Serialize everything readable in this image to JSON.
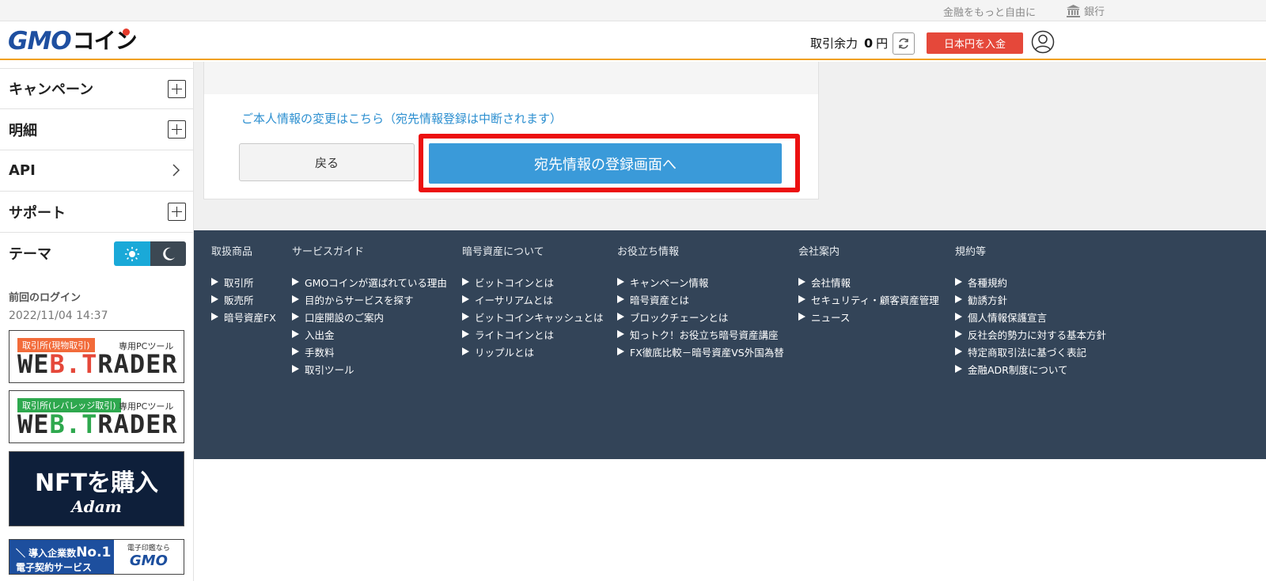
{
  "topbar": {
    "tagline": "金融をもっと自由に",
    "bank_label": "銀行"
  },
  "header": {
    "logo_gmo": "GMO",
    "logo_coin": "コイン",
    "balance_label": "取引余力",
    "balance_value": "0",
    "balance_unit": "円",
    "deposit_label": "日本円を入金"
  },
  "sidebar": {
    "items": [
      {
        "label": "キャンペーン",
        "control": "plus"
      },
      {
        "label": "明細",
        "control": "plus"
      },
      {
        "label": "API",
        "control": "chevron"
      },
      {
        "label": "サポート",
        "control": "plus"
      }
    ],
    "theme_label": "テーマ",
    "last_login_label": "前回のログイン",
    "last_login_value": "2022/11/04 14:37",
    "banners": {
      "webtrader_spot": {
        "tag": "取引所(現物取引)",
        "sub": "専用PCツール",
        "logo": "WEB.TRADER",
        "tag_color": "#f26b3a"
      },
      "webtrader_leverage": {
        "tag": "取引所(レバレッジ取引)",
        "sub": "専用PCツール",
        "logo": "WEB.TRADER",
        "tag_color": "#2ea84e"
      },
      "nft": {
        "title": "NFTを購入",
        "brand": "Adam"
      },
      "sign": {
        "left_top": "＼ 導入企業数",
        "left_big": "No.1",
        "left_bottom": "電子契約サービス",
        "right_small": "電子印鑑なら",
        "right_brand": "GMO"
      }
    }
  },
  "main": {
    "change_link": "ご本人情報の変更はこちら（宛先情報登録は中断されます）",
    "back_button": "戻る",
    "register_button": "宛先情報の登録画面へ"
  },
  "footer": {
    "columns": [
      {
        "heading": "取扱商品",
        "links": [
          "取引所",
          "販売所",
          "暗号資産FX"
        ]
      },
      {
        "heading": "サービスガイド",
        "links": [
          "GMOコインが選ばれている理由",
          "目的からサービスを探す",
          "口座開設のご案内",
          "入出金",
          "手数料",
          "取引ツール"
        ]
      },
      {
        "heading": "暗号資産について",
        "links": [
          "ビットコインとは",
          "イーサリアムとは",
          "ビットコインキャッシュとは",
          "ライトコインとは",
          "リップルとは"
        ]
      },
      {
        "heading": "お役立ち情報",
        "links": [
          "キャンペーン情報",
          "暗号資産とは",
          "ブロックチェーンとは",
          "知っトク！お役立ち暗号資産講座",
          "FX徹底比較－暗号資産VS外国為替"
        ]
      },
      {
        "heading": "会社案内",
        "links": [
          "会社情報",
          "セキュリティ・顧客資産管理",
          "ニュース"
        ]
      },
      {
        "heading": "規約等",
        "links": [
          "各種規約",
          "勧誘方針",
          "個人情報保護宣言",
          "反社会的勢力に対する基本方針",
          "特定商取引法に基づく表記",
          "金融ADR制度について"
        ]
      }
    ]
  },
  "colors": {
    "brand_blue": "#1e4fa0",
    "accent_orange": "#f0a020",
    "deposit_red": "#e5483a",
    "primary_button": "#3a9ad9",
    "highlight_red": "#ec1010",
    "footer_bg": "#334458"
  }
}
